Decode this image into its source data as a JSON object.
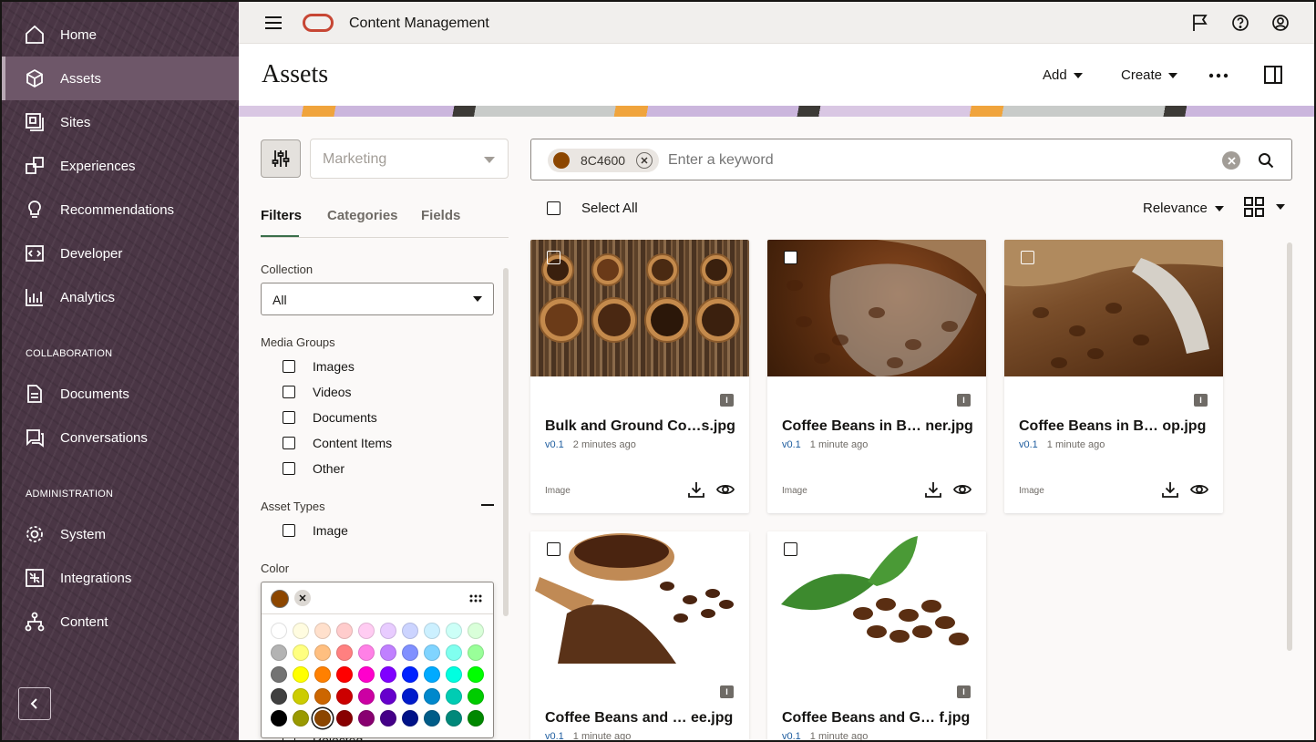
{
  "app": {
    "title": "Content Management"
  },
  "sidebar": {
    "items": [
      {
        "label": "Home",
        "icon": "home-icon"
      },
      {
        "label": "Assets",
        "icon": "cube-icon",
        "active": true
      },
      {
        "label": "Sites",
        "icon": "sites-icon"
      },
      {
        "label": "Experiences",
        "icon": "experiences-icon"
      },
      {
        "label": "Recommendations",
        "icon": "lightbulb-icon"
      },
      {
        "label": "Developer",
        "icon": "code-icon"
      },
      {
        "label": "Analytics",
        "icon": "chart-icon"
      }
    ],
    "collaboration_header": "COLLABORATION",
    "collaboration_items": [
      {
        "label": "Documents",
        "icon": "document-icon"
      },
      {
        "label": "Conversations",
        "icon": "chat-icon"
      }
    ],
    "administration_header": "ADMINISTRATION",
    "administration_items": [
      {
        "label": "System",
        "icon": "gear-icon"
      },
      {
        "label": "Integrations",
        "icon": "integrations-icon"
      },
      {
        "label": "Content",
        "icon": "network-icon"
      }
    ]
  },
  "header": {
    "page_title": "Assets",
    "add_label": "Add",
    "create_label": "Create"
  },
  "filters": {
    "repository_placeholder": "Marketing",
    "tabs": [
      "Filters",
      "Categories",
      "Fields"
    ],
    "active_tab": "Filters",
    "collection_label": "Collection",
    "collection_value": "All",
    "media_groups_label": "Media Groups",
    "media_groups": [
      "Images",
      "Videos",
      "Documents",
      "Content Items",
      "Other"
    ],
    "asset_types_label": "Asset Types",
    "asset_types": [
      "Image"
    ],
    "color_label": "Color",
    "selected_color": "#8C4600",
    "partial_label": "Rejected",
    "palette": [
      [
        "#FFFFFF",
        "#FFFCE0",
        "#FFE0CC",
        "#FFCCCC",
        "#FFCCF2",
        "#E8CCFF",
        "#CCD4FF",
        "#CCF0FF",
        "#CCFFF7",
        "#D9FFD9"
      ],
      [
        "#B3B3B3",
        "#FFFF80",
        "#FFBF80",
        "#FF8080",
        "#FF80E6",
        "#C080FF",
        "#8090FF",
        "#80D4FF",
        "#80FFEF",
        "#99FF99"
      ],
      [
        "#737373",
        "#FFFF00",
        "#FF8000",
        "#FF0000",
        "#FF00CC",
        "#8000FF",
        "#0022FF",
        "#00AAFF",
        "#00FFE0",
        "#00FF00"
      ],
      [
        "#404040",
        "#CCCC00",
        "#CC6600",
        "#CC0000",
        "#CC00A3",
        "#6600CC",
        "#001BCC",
        "#0088CC",
        "#00CCB3",
        "#00CC00"
      ],
      [
        "#000000",
        "#999900",
        "#8C4600",
        "#880000",
        "#880070",
        "#440088",
        "#001288",
        "#005C88",
        "#00887A",
        "#008800"
      ]
    ]
  },
  "search": {
    "chip_label": "8C4600",
    "chip_color": "#8C4600",
    "placeholder": "Enter a keyword"
  },
  "toolbar": {
    "select_all": "Select All",
    "sort_label": "Relevance"
  },
  "assets": [
    {
      "title": "Bulk and Ground Co…s.jpg",
      "version": "v0.1",
      "time": "2 minutes ago",
      "type": "Image",
      "badge": "I"
    },
    {
      "title": "Coffee Beans in B… ner.jpg",
      "version": "v0.1",
      "time": "1 minute ago",
      "type": "Image",
      "badge": "I"
    },
    {
      "title": "Coffee Beans in B… op.jpg",
      "version": "v0.1",
      "time": "1 minute ago",
      "type": "Image",
      "badge": "I"
    },
    {
      "title": "Coffee Beans and … ee.jpg",
      "version": "v0.1",
      "time": "1 minute ago",
      "type": "Image",
      "badge": "I"
    },
    {
      "title": "Coffee Beans and G… f.jpg",
      "version": "v0.1",
      "time": "1 minute ago",
      "type": "Image",
      "badge": "I"
    }
  ],
  "colors": {
    "sidebar_bg": "#4A3645",
    "sidebar_active": "#6E5769",
    "oracle_red": "#C74634",
    "link_blue": "#1D5C9E",
    "filter_tab_underline": "#3A6F4A"
  }
}
